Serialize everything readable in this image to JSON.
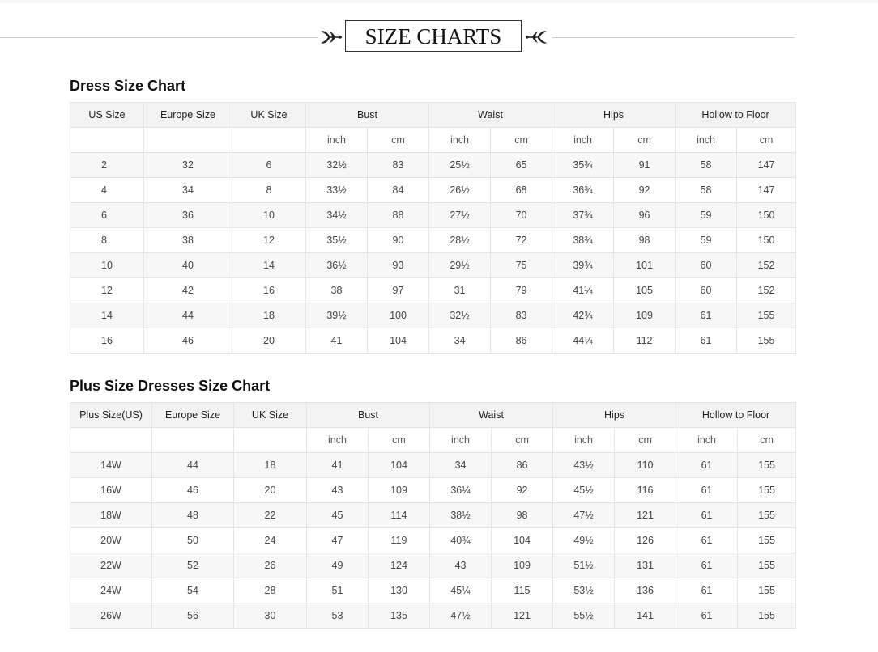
{
  "page_title": "SIZE CHARTS",
  "dress": {
    "title": "Dress Size Chart",
    "headers": [
      "US Size",
      "Europe Size",
      "UK Size",
      "Bust",
      "Waist",
      "Hips",
      "Hollow to Floor"
    ],
    "units": [
      "",
      "",
      "",
      "inch",
      "cm",
      "inch",
      "cm",
      "inch",
      "cm",
      "inch",
      "cm"
    ],
    "rows": [
      [
        "2",
        "32",
        "6",
        "32½",
        "83",
        "25½",
        "65",
        "35¾",
        "91",
        "58",
        "147"
      ],
      [
        "4",
        "34",
        "8",
        "33½",
        "84",
        "26½",
        "68",
        "36¾",
        "92",
        "58",
        "147"
      ],
      [
        "6",
        "36",
        "10",
        "34½",
        "88",
        "27½",
        "70",
        "37¾",
        "96",
        "59",
        "150"
      ],
      [
        "8",
        "38",
        "12",
        "35½",
        "90",
        "28½",
        "72",
        "38¾",
        "98",
        "59",
        "150"
      ],
      [
        "10",
        "40",
        "14",
        "36½",
        "93",
        "29½",
        "75",
        "39¾",
        "101",
        "60",
        "152"
      ],
      [
        "12",
        "42",
        "16",
        "38",
        "97",
        "31",
        "79",
        "41¼",
        "105",
        "60",
        "152"
      ],
      [
        "14",
        "44",
        "18",
        "39½",
        "100",
        "32½",
        "83",
        "42¾",
        "109",
        "61",
        "155"
      ],
      [
        "16",
        "46",
        "20",
        "41",
        "104",
        "34",
        "86",
        "44¼",
        "112",
        "61",
        "155"
      ]
    ]
  },
  "plus": {
    "title": "Plus Size Dresses Size Chart",
    "headers": [
      "Plus Size(US)",
      "Europe Size",
      "UK Size",
      "Bust",
      "Waist",
      "Hips",
      "Hollow to Floor"
    ],
    "units": [
      "",
      "",
      "",
      "inch",
      "cm",
      "inch",
      "cm",
      "inch",
      "cm",
      "inch",
      "cm"
    ],
    "rows": [
      [
        "14W",
        "44",
        "18",
        "41",
        "104",
        "34",
        "86",
        "43½",
        "110",
        "61",
        "155"
      ],
      [
        "16W",
        "46",
        "20",
        "43",
        "109",
        "36¼",
        "92",
        "45½",
        "116",
        "61",
        "155"
      ],
      [
        "18W",
        "48",
        "22",
        "45",
        "114",
        "38½",
        "98",
        "47½",
        "121",
        "61",
        "155"
      ],
      [
        "20W",
        "50",
        "24",
        "47",
        "119",
        "40¾",
        "104",
        "49½",
        "126",
        "61",
        "155"
      ],
      [
        "22W",
        "52",
        "26",
        "49",
        "124",
        "43",
        "109",
        "51½",
        "131",
        "61",
        "155"
      ],
      [
        "24W",
        "54",
        "28",
        "51",
        "130",
        "45¼",
        "115",
        "53½",
        "136",
        "61",
        "155"
      ],
      [
        "26W",
        "56",
        "30",
        "53",
        "135",
        "47½",
        "121",
        "55½",
        "141",
        "61",
        "155"
      ]
    ]
  }
}
